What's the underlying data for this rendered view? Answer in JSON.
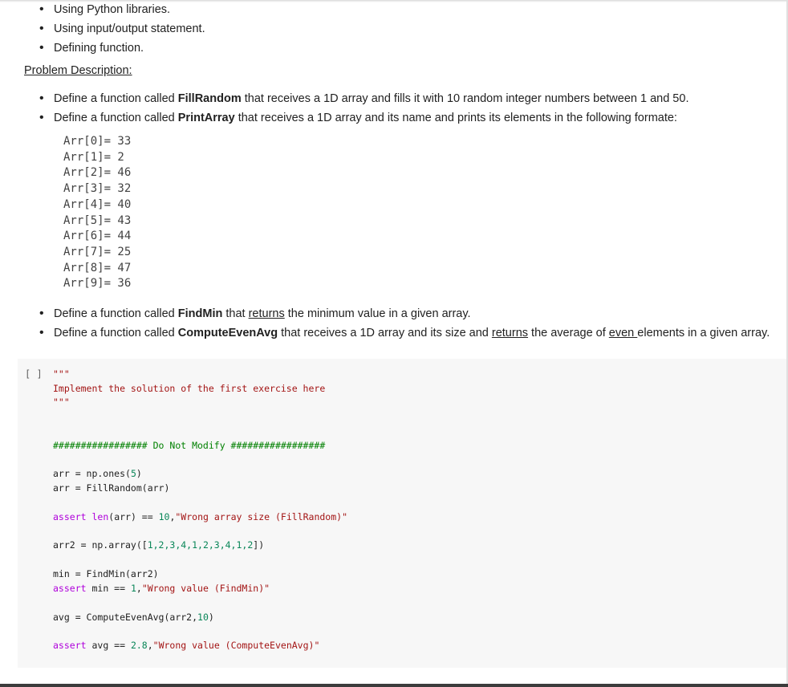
{
  "intro": {
    "items": [
      "Using Python libraries.",
      "Using input/output statement.",
      "Defining function."
    ]
  },
  "problem": {
    "heading": "Problem Description:",
    "fill_random": {
      "pre": "Define a function called ",
      "name": "FillRandom",
      "post": " that receives a 1D array and fills it with 10 random integer numbers between 1 and 50."
    },
    "print_array": {
      "pre": "Define a function called ",
      "name": "PrintArray",
      "post": " that receives a 1D array and its name and prints its elements in the following formate:"
    },
    "example_output": [
      "Arr[0]= 33",
      "Arr[1]= 2",
      "Arr[2]= 46",
      "Arr[3]= 32",
      "Arr[4]= 40",
      "Arr[5]= 43",
      "Arr[6]= 44",
      "Arr[7]= 25",
      "Arr[8]= 47",
      "Arr[9]= 36"
    ],
    "find_min": {
      "pre": "Define a function called ",
      "name": "FindMin",
      "mid": " that ",
      "returns": "returns",
      "post": " the minimum value in a given array."
    },
    "compute_even_avg": {
      "pre": "Define a function called ",
      "name": "ComputeEvenAvg",
      "mid": " that receives a 1D array and its size and ",
      "returns": "returns",
      "mid2": " the average of ",
      "even": "even ",
      "post": "elements in a given array."
    }
  },
  "code_cell": {
    "run_label": "[ ]",
    "lines": {
      "docstring_open": "\"\"\"",
      "docstring_text": "Implement the solution of the first exercise here",
      "docstring_close": "\"\"\"",
      "comment": "################# Do Not Modify #################",
      "arr_ones_a": "arr = np.ones(",
      "arr_ones_num": "5",
      "arr_ones_b": ")",
      "arr_fill": "arr = FillRandom(arr)",
      "assert1_kw": "assert",
      "assert1_len": "len",
      "assert1_mid": "(arr) == ",
      "assert1_num": "10",
      "assert1_comma": ",",
      "assert1_str": "\"Wrong array size (FillRandom)\"",
      "arr2_a": "arr2 = np.array([",
      "arr2_nums": "1,2,3,4,1,2,3,4,1,2",
      "arr2_b": "])",
      "min_line": "min = FindMin(arr2)",
      "assert2_kw": "assert",
      "assert2_mid": " min == ",
      "assert2_num": "1",
      "assert2_comma": ",",
      "assert2_str": "\"Wrong value (FindMin)\"",
      "avg_a": "avg = ComputeEvenAvg(arr2,",
      "avg_num": "10",
      "avg_b": ")",
      "assert3_kw": "assert",
      "assert3_mid": " avg == ",
      "assert3_num": "2.8",
      "assert3_comma": ",",
      "assert3_str": "\"Wrong value (ComputeEvenAvg)\""
    }
  },
  "colors": {
    "string": "#a31515",
    "comment": "#008000",
    "keyword": "#af00db",
    "number": "#098658",
    "code_bg": "#f7f7f7"
  }
}
